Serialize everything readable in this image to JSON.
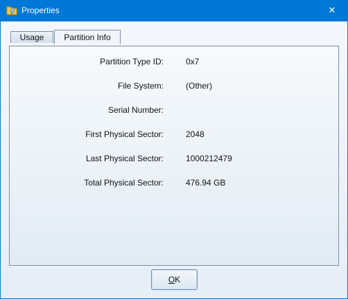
{
  "window": {
    "title": "Properties",
    "close_glyph": "✕",
    "icon": "folder-lightning-icon"
  },
  "tabs": [
    {
      "label": "Usage",
      "selected": false
    },
    {
      "label": "Partition Info",
      "selected": true
    }
  ],
  "partition_info": [
    {
      "label": "Partition Type ID:",
      "value": "0x7"
    },
    {
      "label": "File System:",
      "value": "(Other)"
    },
    {
      "label": "Serial Number:",
      "value": ""
    },
    {
      "label": "First Physical Sector:",
      "value": "2048"
    },
    {
      "label": "Last Physical Sector:",
      "value": "1000212479"
    },
    {
      "label": "Total Physical Sector:",
      "value": "476.94 GB"
    }
  ],
  "buttons": {
    "ok_label_mnemonic": "O",
    "ok_label_rest": "K"
  },
  "colors": {
    "titlebar": "#0078d7",
    "panel_border": "#7a8ea3"
  }
}
